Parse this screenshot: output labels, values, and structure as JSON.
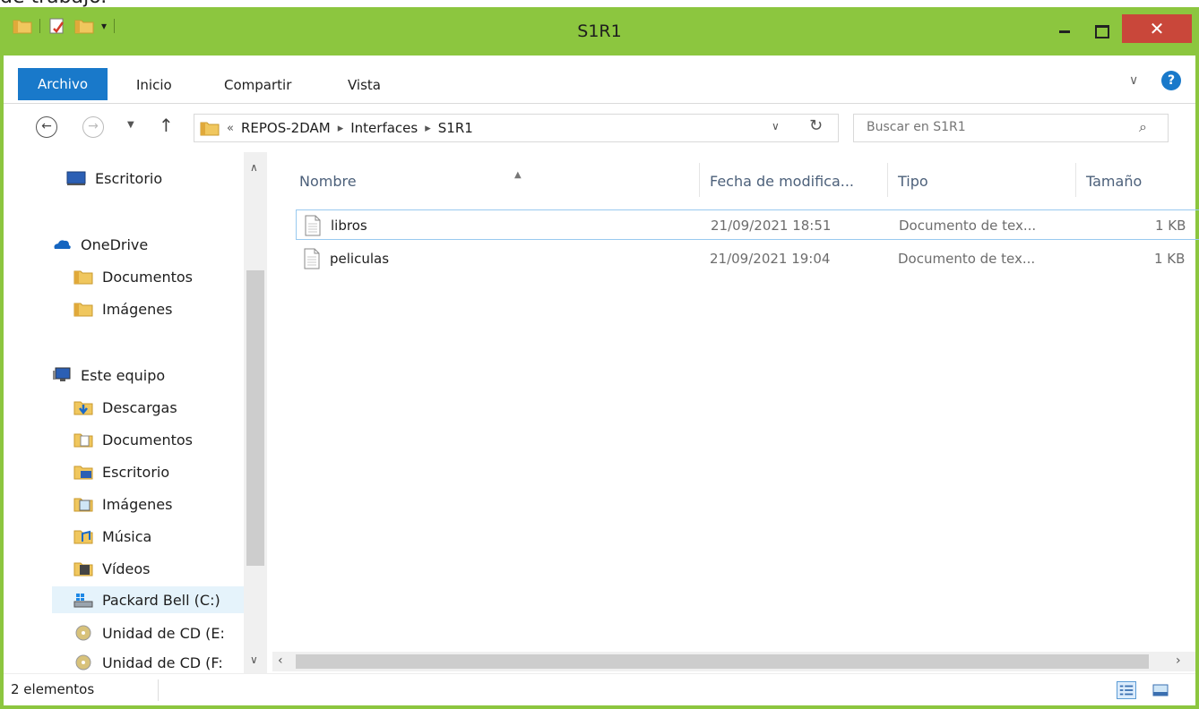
{
  "window": {
    "title": "S1R1"
  },
  "titlebar": {
    "close_label": "✕"
  },
  "ribbon": {
    "tabs": [
      "Archivo",
      "Inicio",
      "Compartir",
      "Vista"
    ],
    "help_label": "?"
  },
  "address": {
    "overflow": "«",
    "crumbs": [
      "REPOS-2DAM",
      "Interfaces",
      "S1R1"
    ]
  },
  "search": {
    "placeholder": "Buscar en S1R1"
  },
  "navpane": {
    "items": [
      {
        "label": "Escritorio",
        "icon": "desktop-icon"
      },
      {
        "label": "OneDrive",
        "icon": "onedrive-icon"
      },
      {
        "label": "Documentos",
        "icon": "folder-icon"
      },
      {
        "label": "Imágenes",
        "icon": "folder-icon"
      },
      {
        "label": "Este equipo",
        "icon": "computer-icon"
      },
      {
        "label": "Descargas",
        "icon": "downloads-folder-icon"
      },
      {
        "label": "Documentos",
        "icon": "documents-folder-icon"
      },
      {
        "label": "Escritorio",
        "icon": "desktop-folder-icon"
      },
      {
        "label": "Imágenes",
        "icon": "pictures-folder-icon"
      },
      {
        "label": "Música",
        "icon": "music-folder-icon"
      },
      {
        "label": "Vídeos",
        "icon": "videos-folder-icon"
      },
      {
        "label": "Packard Bell (C:)",
        "icon": "drive-icon"
      },
      {
        "label": "Unidad de CD (E:",
        "icon": "cd-drive-icon"
      },
      {
        "label": "Unidad de CD (F:",
        "icon": "cd-drive-icon"
      }
    ],
    "selected_index": 11
  },
  "columns": {
    "name": "Nombre",
    "date": "Fecha de modifica...",
    "type": "Tipo",
    "size": "Tamaño"
  },
  "files": [
    {
      "name": "libros",
      "date": "21/09/2021 18:51",
      "type": "Documento de tex...",
      "size": "1 KB",
      "selected": true
    },
    {
      "name": "peliculas",
      "date": "21/09/2021 19:04",
      "type": "Documento de tex...",
      "size": "1 KB",
      "selected": false
    }
  ],
  "status": {
    "count": "2 elementos"
  },
  "colors": {
    "titlebar": "#8cc63f",
    "file_tab": "#1979ca",
    "close_button": "#c9473a",
    "selection_border": "#99c9ef"
  },
  "top_snippet": {
    "text": "de trabajo."
  }
}
